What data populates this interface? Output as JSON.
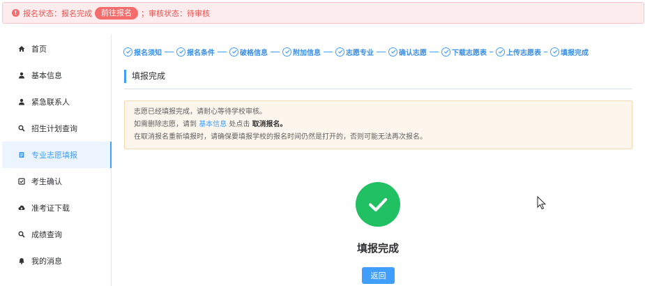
{
  "alert": {
    "status_label": "报名状态：报名完成",
    "action_button": "前往报名",
    "separator": "；",
    "review_label": "审核状态：待审核"
  },
  "sidebar": {
    "items": [
      {
        "label": "首页",
        "icon": "home-icon"
      },
      {
        "label": "基本信息",
        "icon": "user-icon"
      },
      {
        "label": "紧急联系人",
        "icon": "user-icon"
      },
      {
        "label": "招生计划查询",
        "icon": "search-icon"
      },
      {
        "label": "专业志愿填报",
        "icon": "document-icon"
      },
      {
        "label": "考生确认",
        "icon": "checkbox-icon"
      },
      {
        "label": "准考证下载",
        "icon": "cloud-download-icon"
      },
      {
        "label": "成绩查询",
        "icon": "search-icon"
      },
      {
        "label": "我的消息",
        "icon": "bell-icon"
      }
    ],
    "active_index": 4
  },
  "steps": [
    "报名须知",
    "报名条件",
    "破格信息",
    "附加信息",
    "志愿专业",
    "确认志愿",
    "下载志愿表",
    "上传志愿表",
    "填报完成"
  ],
  "section": {
    "title": "填报完成"
  },
  "notice": {
    "line1": "志愿已经填报完成，请耐心等待学校审核。",
    "line2_prefix": "如需删除志愿，请到",
    "line2_link": "基本信息",
    "line2_middle": "处点击",
    "line2_strong": "取消报名。",
    "line3": "在取消报名重新填报时，请确保要填报学校的报名时间仍然是打开的，否则可能无法再次报名。"
  },
  "result": {
    "title": "填报完成",
    "back_button": "返回"
  },
  "colors": {
    "primary": "#409eff",
    "success": "#20c063",
    "danger": "#f56c6c",
    "warning_bg": "#fdf6ec"
  }
}
